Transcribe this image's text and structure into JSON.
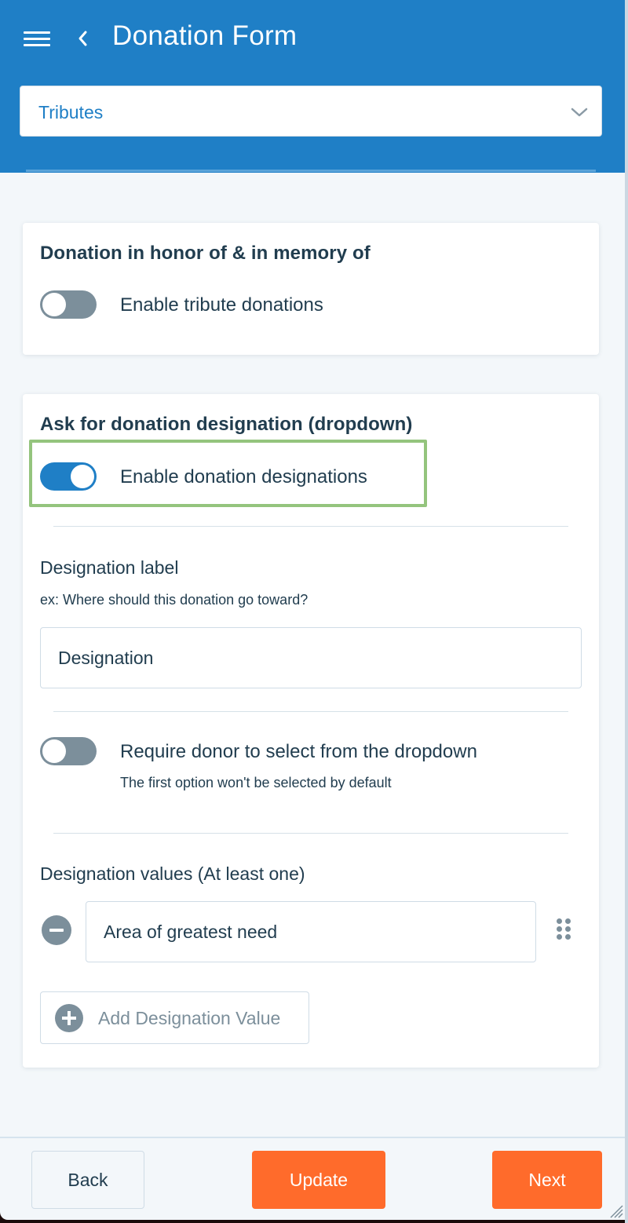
{
  "header": {
    "title": "Donation Form",
    "section_select": {
      "selected": "Tributes"
    }
  },
  "tribute_card": {
    "title": "Donation in honor of & in memory of",
    "toggle": {
      "label": "Enable tribute donations",
      "enabled": false
    }
  },
  "designation_card": {
    "title": "Ask for donation designation (dropdown)",
    "enable_toggle": {
      "label": "Enable donation designations",
      "enabled": true
    },
    "designation_label": {
      "label": "Designation label",
      "help": "ex: Where should this donation go toward?",
      "value": "Designation"
    },
    "require_toggle": {
      "label": "Require donor to select from the dropdown",
      "help": "The first option won't be selected by default",
      "enabled": false
    },
    "values_section": {
      "label": "Designation values (At least one)",
      "values": [
        "Area of greatest need"
      ],
      "add_label": "Add Designation Value"
    }
  },
  "footer": {
    "back_label": "Back",
    "update_label": "Update",
    "next_label": "Next"
  },
  "colors": {
    "brand_blue": "#1f7fc6",
    "action_orange": "#ff6b2b",
    "highlight_green": "#94c47d",
    "text_dark": "#213d4f",
    "muted_gray": "#7c8f9b"
  }
}
